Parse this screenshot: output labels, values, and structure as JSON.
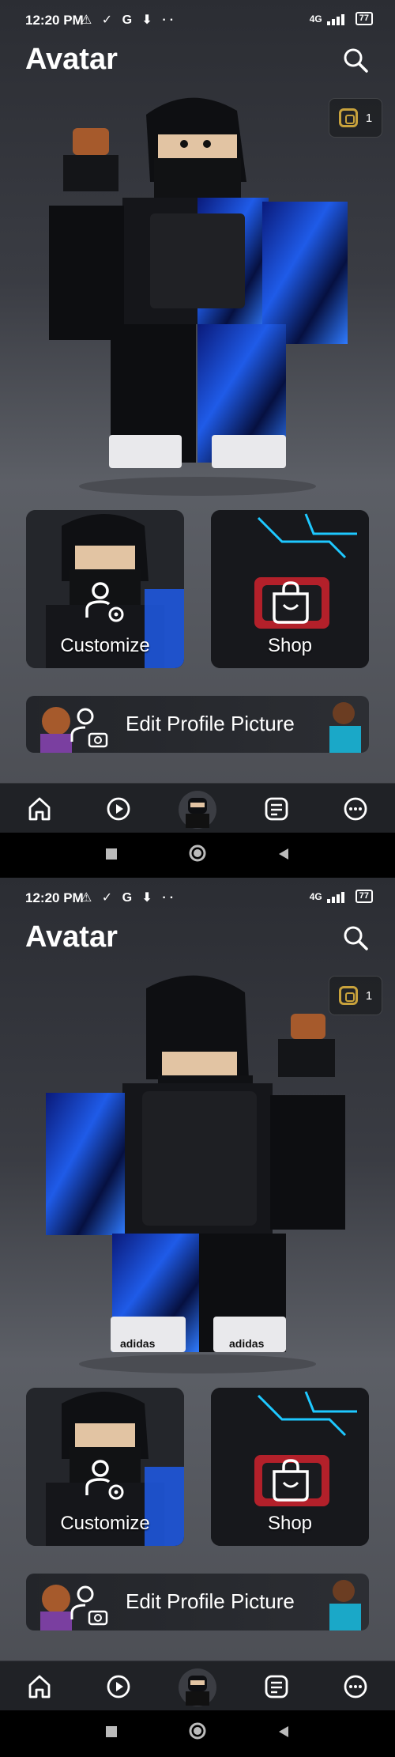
{
  "screens": [
    {
      "status": {
        "time": "12:20 PM",
        "icons": "⚠ ✓ G ⬇ ··",
        "network": "4G",
        "battery": "77"
      },
      "header": {
        "title": "Avatar"
      },
      "currency": {
        "robux": "1"
      },
      "cards": {
        "customize_label": "Customize",
        "shop_label": "Shop"
      },
      "profile": {
        "edit_label": "Edit Profile Picture"
      },
      "view": "front"
    },
    {
      "status": {
        "time": "12:20 PM",
        "icons": "⚠ ✓ G ⬇ ··",
        "network": "4G",
        "battery": "77"
      },
      "header": {
        "title": "Avatar"
      },
      "currency": {
        "robux": "1"
      },
      "cards": {
        "customize_label": "Customize",
        "shop_label": "Shop"
      },
      "profile": {
        "edit_label": "Edit Profile Picture"
      },
      "view": "back",
      "shoe_brand": "adidas"
    }
  ],
  "nav": [
    "home-icon",
    "play-icon",
    "avatar-icon",
    "chat-icon",
    "more-icon"
  ],
  "colors": {
    "accent_blue": "#1f5be8",
    "robux_gold": "#c8a23c",
    "background": "#3a3c43"
  }
}
